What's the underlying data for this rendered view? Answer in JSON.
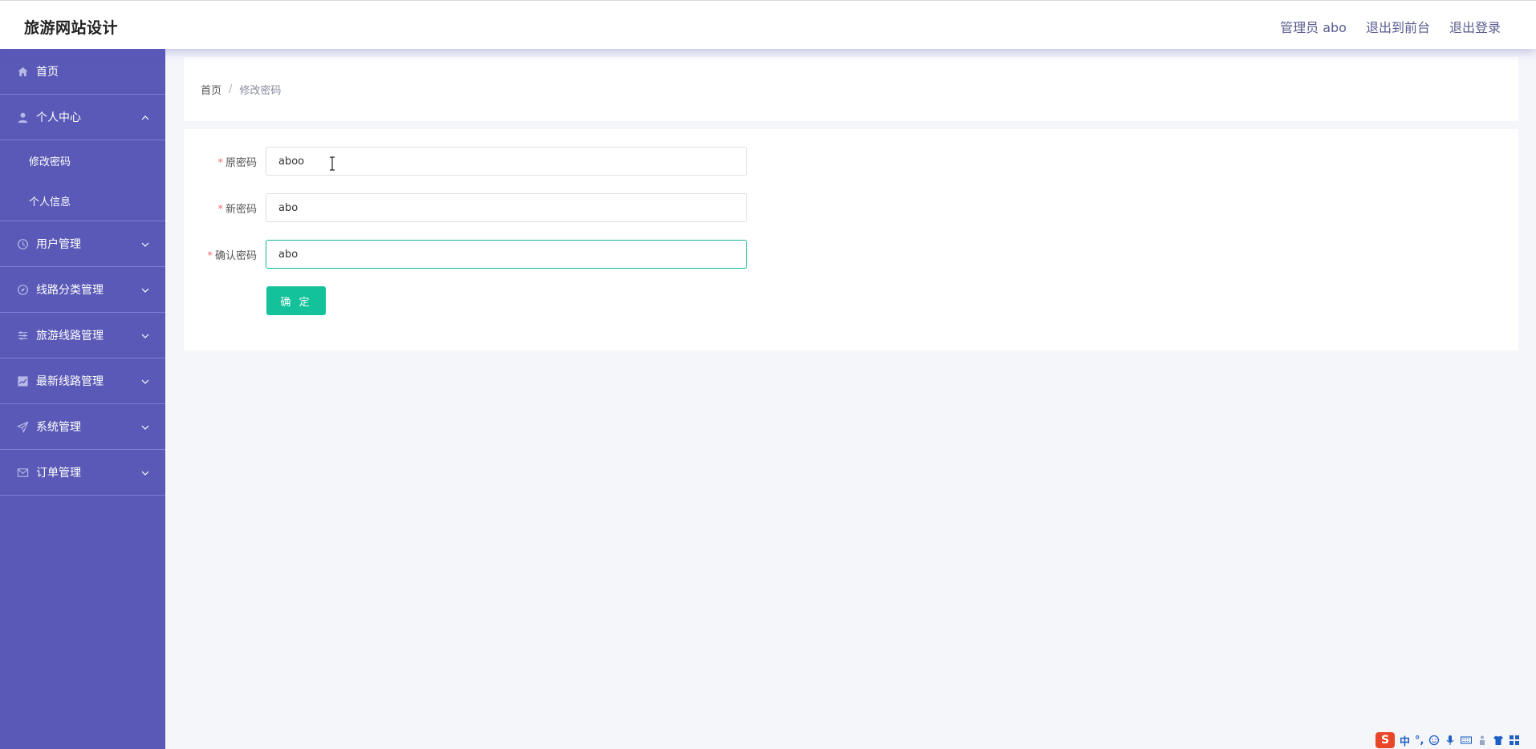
{
  "header": {
    "site_title": "旅游网站设计",
    "admin_label": "管理员 abo",
    "front_label": "退出到前台",
    "logout_label": "退出登录"
  },
  "sidebar": {
    "home": "首页",
    "personal_center": "个人中心",
    "personal_sub": [
      "修改密码",
      "个人信息"
    ],
    "items": [
      "用户管理",
      "线路分类管理",
      "旅游线路管理",
      "最新线路管理",
      "系统管理",
      "订单管理"
    ]
  },
  "breadcrumb": {
    "home": "首页",
    "separator": "/",
    "current": "修改密码"
  },
  "form": {
    "old_password_label": "原密码",
    "old_password_value": "aboo",
    "new_password_label": "新密码",
    "new_password_value": "abo",
    "confirm_password_label": "确认密码",
    "confirm_password_value": "abo",
    "required_mark": "*",
    "submit_label": "确 定"
  },
  "ime": {
    "logo": "S",
    "mode": "中",
    "punct": "°,"
  },
  "colors": {
    "sidebar_bg": "#5a59b7",
    "accent": "#13c29a",
    "required": "#f56c6c"
  }
}
